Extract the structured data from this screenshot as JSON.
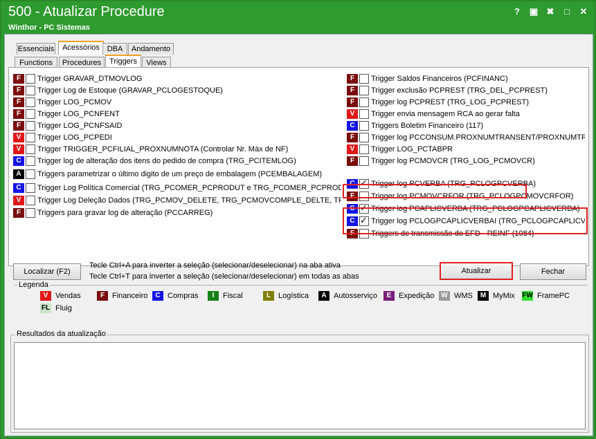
{
  "window": {
    "title": "500 - Atualizar Procedure",
    "subtitle": "Winthor - PC Sistemas",
    "controls": [
      "?",
      "▣",
      "✖",
      "□",
      "✕"
    ]
  },
  "tabs_top": [
    "Essenciais",
    "Acessórios",
    "DBA",
    "Andamento"
  ],
  "tabs_sub": [
    "Functions",
    "Procedures",
    "Triggers",
    "Views"
  ],
  "badge_colors": {
    "V": "#e01818",
    "F": "#7a0e0e",
    "C": "#1414e6",
    "I": "#158015",
    "L": "#7f7f00",
    "A": "#000000",
    "E": "#7a1e7a",
    "W": "#9a9a9a",
    "M": "#000000",
    "FW": "#33dd33",
    "FL": "#c8e6c8"
  },
  "left_triggers": [
    {
      "badge": "F",
      "checked": false,
      "label": "Trigger GRAVAR_DTMOVLOG"
    },
    {
      "badge": "F",
      "checked": false,
      "label": "Trigger Log de Estoque (GRAVAR_PCLOGESTOQUE)"
    },
    {
      "badge": "F",
      "checked": false,
      "label": "Trigger LOG_PCMOV"
    },
    {
      "badge": "F",
      "checked": false,
      "label": "Trigger LOG_PCNFENT"
    },
    {
      "badge": "F",
      "checked": false,
      "label": "Trigger LOG_PCNFSAID"
    },
    {
      "badge": "V",
      "checked": false,
      "label": "Trigger LOG_PCPEDI"
    },
    {
      "badge": "V",
      "checked": false,
      "label": "Trigger TRIGGER_PCFILIAL_PROXNUMNOTA (Controlar Nr. Máx de NF)"
    },
    {
      "badge": "C",
      "checked": false,
      "label": "Trigger log de alteração dos itens do pedido de compra (TRG_PCITEMLOG)"
    },
    {
      "badge": "A",
      "checked": false,
      "label": "Triggers parametrizar o último digito de um preço de embalagem (PCEMBALAGEM)"
    },
    {
      "badge": "C",
      "checked": false,
      "label": "Trigger Log Política Comercial (TRG_PCOMER_PCPRODUT e TRG_PCOMER_PCPRODFILIAL)"
    },
    {
      "badge": "V",
      "checked": false,
      "label": "Trigger Log Deleção Dados (TRG_PCMOV_DELETE, TRG_PCMOVCOMPLE_DELTE, TRG_PCNF"
    },
    {
      "badge": "F",
      "checked": false,
      "label": "Triggers para gravar log de alteração (PCCARREG)"
    }
  ],
  "right_triggers": [
    {
      "badge": "F",
      "checked": false,
      "label": "Trigger Saldos Financeiros (PCFINANC)"
    },
    {
      "badge": "F",
      "checked": false,
      "label": "Trigger exclusão PCPREST (TRG_DEL_PCPREST)"
    },
    {
      "badge": "F",
      "checked": false,
      "label": "Trigger log PCPREST (TRG_LOG_PCPREST)"
    },
    {
      "badge": "V",
      "checked": false,
      "label": "Trigger envia mensagem RCA ao gerar falta"
    },
    {
      "badge": "C",
      "checked": false,
      "label": "Triggers Boletim Financeiro (117)"
    },
    {
      "badge": "F",
      "checked": false,
      "label": "Trigger log  PCCONSUM.PROXNUMTRANSENT/PROXNUMTRANSV"
    },
    {
      "badge": "V",
      "checked": false,
      "label": "Trigger LOG_PCTABPR"
    },
    {
      "badge": "F",
      "checked": false,
      "label": "Trigger log PCMOVCR (TRG_LOG_PCMOVCR)"
    },
    {
      "badge": "C",
      "checked": true,
      "label": "Trigger log PCVERBA (TRG_PCLOGPCVERBA)"
    },
    {
      "badge": "F",
      "checked": false,
      "label": "Trigger log PCMOVCRFOR  (TRG_PCLOGPCMOVCRFOR)"
    },
    {
      "badge": "C",
      "checked": true,
      "label": "Trigger log PCAPLICVERBA  (TRG_PCLOGPCAPLICVERBA)"
    },
    {
      "badge": "C",
      "checked": true,
      "label": "Trigger log PCLOGPCAPLICVERBAI  (TRG_PCLOGPCAPLICVERBA"
    },
    {
      "badge": "F",
      "checked": false,
      "label": "Triggers de transmissão do EFD - REINF (1084)"
    }
  ],
  "buttons": {
    "localizar": "Localizar (F2)",
    "atualizar": "Atualizar",
    "fechar": "Fechar"
  },
  "hints": [
    "Tecle Ctrl+A para inverter a seleção (selecionar/deselecionar) na aba ativa",
    "Tecle Ctrl+T para inverter a seleção (selecionar/deselecionar) em todas as abas"
  ],
  "legend": {
    "title": "Legenda",
    "items": [
      {
        "badge": "V",
        "label": "Vendas"
      },
      {
        "badge": "F",
        "label": "Financeiro"
      },
      {
        "badge": "C",
        "label": "Compras"
      },
      {
        "badge": "I",
        "label": "Fiscal"
      },
      {
        "badge": "L",
        "label": "Logística"
      },
      {
        "badge": "A",
        "label": "Autosserviço"
      },
      {
        "badge": "E",
        "label": "Expedição"
      },
      {
        "badge": "W",
        "label": "WMS"
      },
      {
        "badge": "M",
        "label": "MyMix"
      },
      {
        "badge": "FW",
        "label": "FramePC"
      },
      {
        "badge": "FL",
        "label": "Fluig"
      }
    ]
  },
  "results": {
    "title": "Resultados da atualização",
    "content": ""
  }
}
